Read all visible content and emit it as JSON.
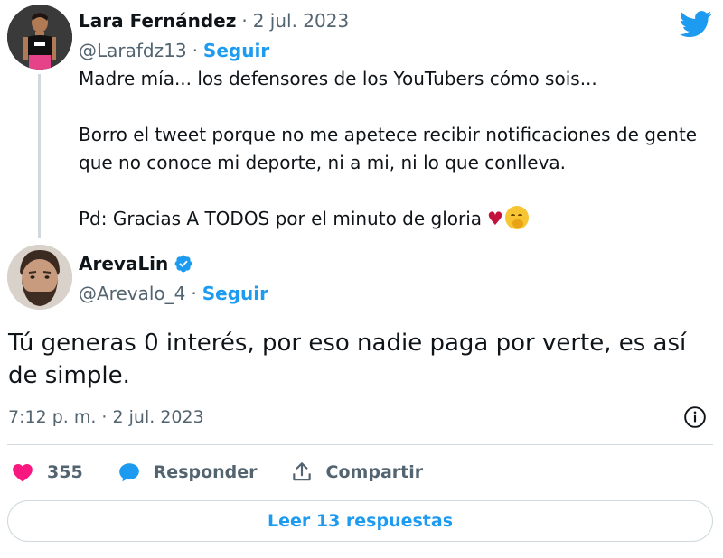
{
  "parent_tweet": {
    "name": "Lara Fernández",
    "separator": "·",
    "date": "2 jul. 2023",
    "handle": "@Larafdz13",
    "follow_label": "Seguir",
    "lines": [
      "Madre mía... los defensores de los YouTubers cómo sois...",
      "Borro el tweet porque no me apetece recibir notificaciones de gente",
      "que no conoce mi deporte, ni a mi, ni lo que conlleva.",
      "Pd: Gracias A TODOS por el minuto de gloria"
    ],
    "emojis": [
      "heart-emoji",
      "face-with-hand-over-mouth-emoji"
    ]
  },
  "main_tweet": {
    "name": "ArevaLin",
    "verified": true,
    "handle": "@Arevalo_4",
    "separator": "·",
    "follow_label": "Seguir",
    "text": "Tú generas 0 interés, por eso nadie paga por verte, es así de simple.",
    "timestamp": "7:12 p. m. · 2 jul. 2023"
  },
  "actions": {
    "like_count": "355",
    "reply_label": "Responder",
    "share_label": "Compartir"
  },
  "replies_button_label": "Leer 13 respuestas",
  "colors": {
    "brand": "#1d9bf0",
    "text": "#0f1419",
    "muted": "#536471",
    "like": "#f91880",
    "border": "#cfd9de"
  }
}
